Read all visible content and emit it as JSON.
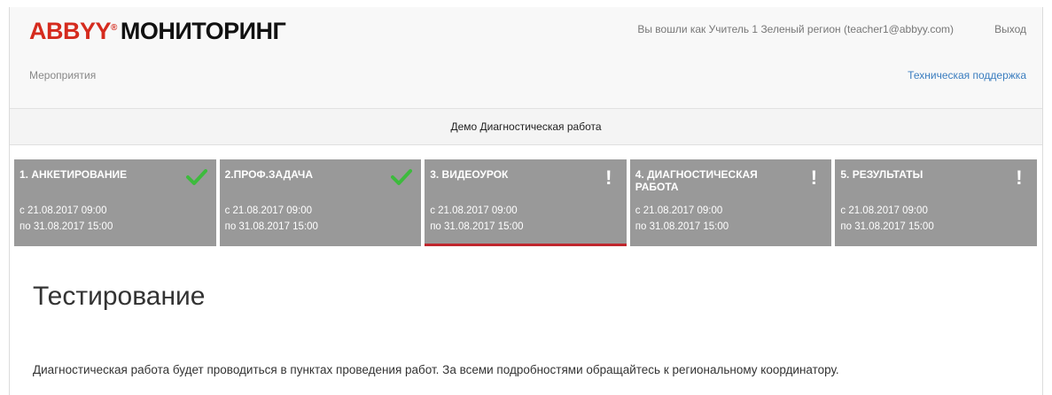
{
  "header": {
    "brand": "ABBYY",
    "registered": "®",
    "product": "МОНИТОРИНГ",
    "user_info": "Вы вошли как Учитель 1 Зеленый регион (teacher1@abbyy.com)",
    "logout": "Выход"
  },
  "nav": {
    "events": "Мероприятия",
    "support": "Техническая поддержка"
  },
  "event_title": "Демо Диагностическая работа",
  "steps": [
    {
      "title": "1. АНКЕТИРОВАНИЕ",
      "from": "с 21.08.2017 09:00",
      "to": "по 31.08.2017 15:00",
      "status": "completed",
      "status_icon": "check-icon",
      "status_color": "#3dbb3d"
    },
    {
      "title": "2.ПРОФ.ЗАДАЧА",
      "from": "с 21.08.2017 09:00",
      "to": "по 31.08.2017 15:00",
      "status": "completed",
      "status_icon": "check-icon",
      "status_color": "#3dbb3d"
    },
    {
      "title": "3. ВИДЕОУРОК",
      "from": "с 21.08.2017 09:00",
      "to": "по 31.08.2017 15:00",
      "status": "warning",
      "status_icon": "exclamation-icon",
      "status_color": "#ffffff",
      "active": true
    },
    {
      "title": "4. ДИАГНОСТИЧЕСКАЯ РАБОТА",
      "from": "с 21.08.2017 09:00",
      "to": "по 31.08.2017 15:00",
      "status": "warning",
      "status_icon": "exclamation-icon",
      "status_color": "#ffffff"
    },
    {
      "title": "5. РЕЗУЛЬТАТЫ",
      "from": "с 21.08.2017 09:00",
      "to": "по 31.08.2017 15:00",
      "status": "warning",
      "status_icon": "exclamation-icon",
      "status_color": "#ffffff"
    }
  ],
  "content": {
    "heading": "Тестирование",
    "text": "Диагностическая работа будет проводиться в пунктах проведения работ. За всеми подробностями обращайтесь к региональному координатору."
  },
  "colors": {
    "brand": "#d52b1e",
    "step_bg": "#999999",
    "active_underline": "#c0262d",
    "link": "#3a7dbf"
  }
}
